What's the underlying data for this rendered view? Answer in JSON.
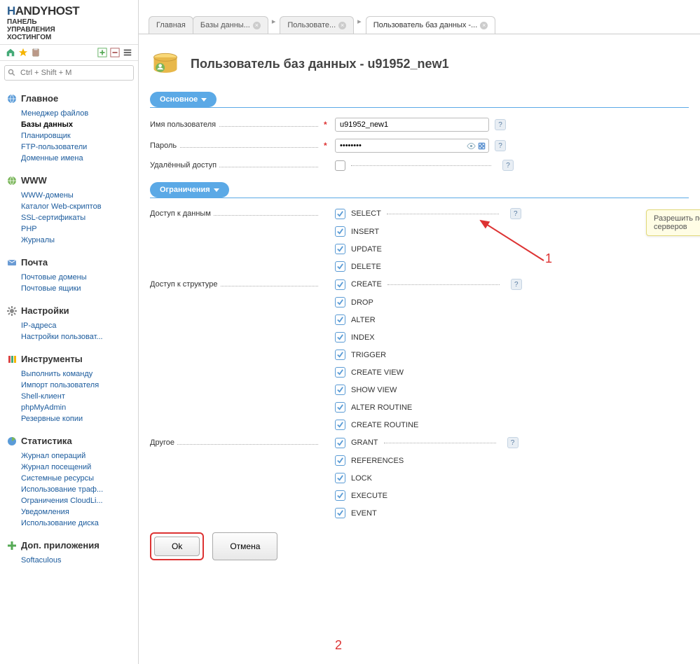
{
  "brand": {
    "name": "HANDYHOST",
    "subtitle": "ПАНЕЛЬ\nУПРАВЛЕНИЯ\nХОСТИНГОМ"
  },
  "search": {
    "placeholder": "Ctrl + Shift + M"
  },
  "nav": [
    {
      "title": "Главное",
      "icon": "globe-blue",
      "items": [
        {
          "label": "Менеджер файлов"
        },
        {
          "label": "Базы данных",
          "active": true
        },
        {
          "label": "Планировщик"
        },
        {
          "label": "FTP-пользователи"
        },
        {
          "label": "Доменные имена"
        }
      ]
    },
    {
      "title": "WWW",
      "icon": "globe-green",
      "items": [
        {
          "label": "WWW-домены"
        },
        {
          "label": "Каталог Web-скриптов"
        },
        {
          "label": "SSL-сертификаты"
        },
        {
          "label": "PHP"
        },
        {
          "label": "Журналы"
        }
      ]
    },
    {
      "title": "Почта",
      "icon": "mail",
      "items": [
        {
          "label": "Почтовые домены"
        },
        {
          "label": "Почтовые ящики"
        }
      ]
    },
    {
      "title": "Настройки",
      "icon": "gear",
      "items": [
        {
          "label": "IP-адреса"
        },
        {
          "label": "Настройки пользоват..."
        }
      ]
    },
    {
      "title": "Инструменты",
      "icon": "tools",
      "items": [
        {
          "label": "Выполнить команду"
        },
        {
          "label": "Импорт пользователя"
        },
        {
          "label": "Shell-клиент"
        },
        {
          "label": "phpMyAdmin"
        },
        {
          "label": "Резервные копии"
        }
      ]
    },
    {
      "title": "Статистика",
      "icon": "chart",
      "items": [
        {
          "label": "Журнал операций"
        },
        {
          "label": "Журнал посещений"
        },
        {
          "label": "Системные ресурсы"
        },
        {
          "label": "Использование траф..."
        },
        {
          "label": "Ограничения CloudLi..."
        },
        {
          "label": "Уведомления"
        },
        {
          "label": "Использование диска"
        }
      ]
    },
    {
      "title": "Доп. приложения",
      "icon": "plus",
      "items": [
        {
          "label": "Softaculous"
        }
      ]
    }
  ],
  "tabs": [
    {
      "label": "Главная",
      "closable": false
    },
    {
      "label": "Базы данны...",
      "closable": true
    },
    {
      "label": "Пользовате...",
      "closable": true
    },
    {
      "label": "Пользователь баз данных -...",
      "closable": true,
      "active": true
    }
  ],
  "page": {
    "title": "Пользователь баз данных - u91952_new1",
    "section_main": "Основное",
    "section_limits": "Ограничения",
    "username_label": "Имя пользователя",
    "username_value": "u91952_new1",
    "password_label": "Пароль",
    "password_value": "••••••••",
    "remote_label": "Удалённый доступ",
    "data_access_label": "Доступ к данным",
    "data_perms": [
      "SELECT",
      "INSERT",
      "UPDATE",
      "DELETE"
    ],
    "struct_access_label": "Доступ к структуре",
    "struct_perms": [
      "CREATE",
      "DROP",
      "ALTER",
      "INDEX",
      "TRIGGER",
      "CREATE VIEW",
      "SHOW VIEW",
      "ALTER ROUTINE",
      "CREATE ROUTINE"
    ],
    "other_label": "Другое",
    "other_perms": [
      "GRANT",
      "REFERENCES",
      "LOCK",
      "EXECUTE",
      "EVENT"
    ],
    "ok": "Ok",
    "cancel": "Отмена"
  },
  "tooltip": "Разрешить пользователю баз данных доступ с удал\nсерверов",
  "annotations": {
    "one": "1",
    "two": "2"
  }
}
